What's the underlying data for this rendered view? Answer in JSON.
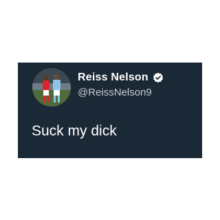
{
  "tweet": {
    "author": {
      "display_name": "Reiss Nelson",
      "handle": "@ReissNelson9",
      "verified": true
    },
    "text": "Suck my dick"
  },
  "colors": {
    "card_background": "#1b2836",
    "page_background": "#ffffff",
    "verified_badge": "#ffffff",
    "handle_text": "#c7ccd1"
  },
  "icons": {
    "verified": "verified-badge-icon",
    "avatar": "avatar-photo"
  }
}
